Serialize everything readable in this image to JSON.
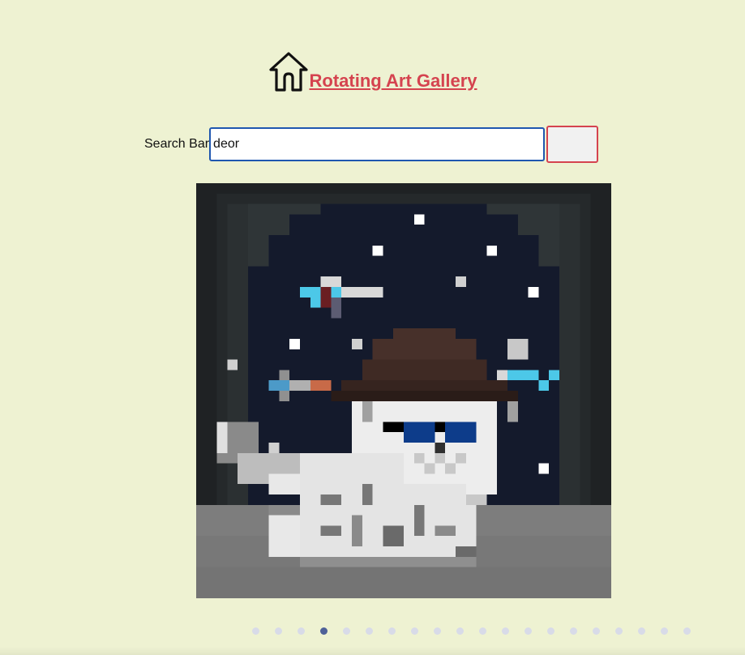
{
  "header": {
    "title": "Rotating Art Gallery",
    "home_icon": "home-icon",
    "title_color": "#d5434f"
  },
  "search": {
    "label": "Search Bar",
    "value": "deor",
    "button_label": ""
  },
  "artwork": {
    "type": "pixel-art",
    "description_icon": "pixel-art-image"
  },
  "carousel": {
    "total_slides": 20,
    "active_index": 3,
    "active_color": "#4e6198",
    "inactive_color": "#d8dbe8"
  },
  "colors": {
    "background": "#eef2d2",
    "input_border": "#1f57b0",
    "button_border": "#d5434f"
  }
}
